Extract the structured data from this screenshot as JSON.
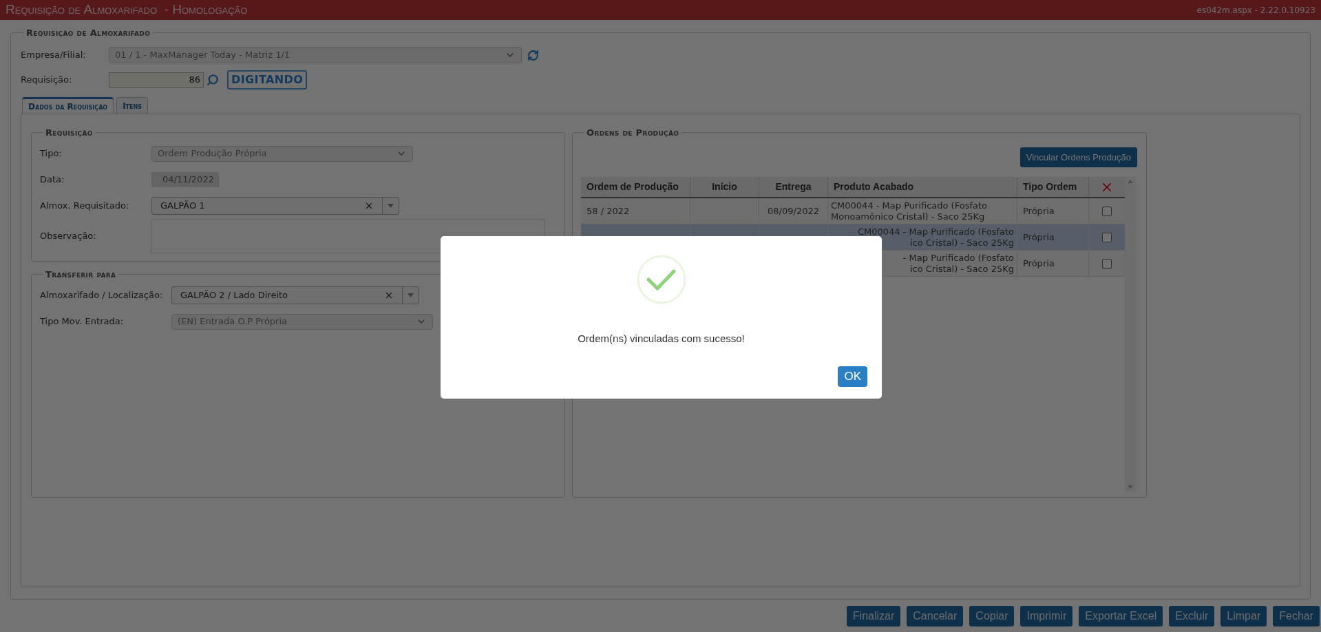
{
  "window": {
    "title": "Requisição de Almoxarifado  - Homologação",
    "version": "es042m.aspx - 2.22.0.10923"
  },
  "header_section": {
    "legend": "Requisição de Almoxarifado",
    "empresa": {
      "label": "Empresa/Filial:",
      "value": "01 / 1 - MaxManager Today - Matriz 1/1"
    },
    "requisicao": {
      "label": "Requisição:",
      "value": "86",
      "status": "DIGITANDO"
    }
  },
  "tabs": [
    {
      "label": "Dados da Requisição",
      "selected": true
    },
    {
      "label": "Itens",
      "selected": false
    }
  ],
  "requisicao": {
    "legend": "Requisição",
    "fields": [
      {
        "kind": "select",
        "label": "Tipo:",
        "value": "Ordem Produção Própria"
      },
      {
        "kind": "date",
        "label": "Data:",
        "value": "04/11/2022"
      },
      {
        "kind": "combo",
        "label": "Almox. Requisitado:",
        "value": "GALPÃO 1"
      },
      {
        "kind": "textarea",
        "label": "Observação:"
      }
    ]
  },
  "transferir": {
    "legend": "Transferir para",
    "fields": [
      {
        "kind": "combo",
        "label": "Almoxarifado / Localização:",
        "value": "GALPÃO 2 / Lado Direito"
      },
      {
        "kind": "select",
        "label": "Tipo Mov. Entrada:",
        "value": "(EN) Entrada O.P Própria"
      }
    ]
  },
  "ordens": {
    "legend": "Ordens de Produção",
    "button": "Vincular Ordens Produção",
    "columns": [
      "Ordem de Produção",
      "Início",
      "Entrega",
      "Produto Acabado",
      "Tipo Ordem"
    ],
    "rows": [
      {
        "ordem": "58 / 2022",
        "entrega": "08/09/2022",
        "produto": [
          "CM00044 - Map Purificado (Fosfato",
          "Monoamônico Cristal) - Saco 25Kg"
        ],
        "tipo": "Própria",
        "checked": false,
        "selected": false
      },
      {
        "produto": [
          "CM00044 - Map Purificado (Fosfato",
          "ico Cristal) - Saco 25Kg"
        ],
        "tipo": "Própria",
        "checked": false,
        "selected": true
      },
      {
        "produto": [
          "- Map Purificado (Fosfato",
          "ico Cristal) - Saco 25Kg"
        ],
        "tipo": "Própria",
        "checked": false,
        "selected": false
      }
    ]
  },
  "footer_buttons": [
    "Finalizar",
    "Cancelar",
    "Copiar",
    "Imprimir",
    "Exportar Excel",
    "Excluir",
    "Limpar",
    "Fechar"
  ],
  "dialog": {
    "message": "Ordem(ns) vinculadas com sucesso!",
    "button": "OK"
  }
}
